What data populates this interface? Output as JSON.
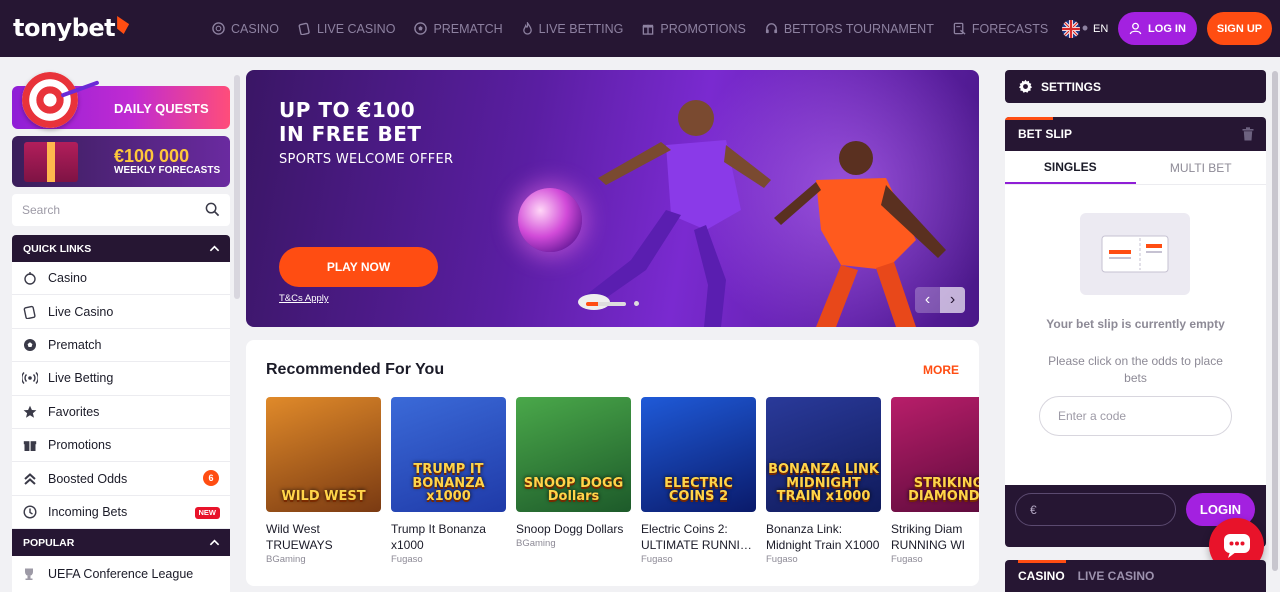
{
  "brand": {
    "name": "tonybet",
    "accent": "#ff4d12",
    "purple": "#a321e0",
    "dark": "#261633"
  },
  "nav": {
    "items": [
      {
        "label": "CASINO",
        "icon": "casino-chip-icon"
      },
      {
        "label": "LIVE CASINO",
        "icon": "live-casino-icon"
      },
      {
        "label": "PREMATCH",
        "icon": "soccer-ball-icon"
      },
      {
        "label": "LIVE BETTING",
        "icon": "flame-icon"
      },
      {
        "label": "PROMOTIONS",
        "icon": "gift-icon"
      },
      {
        "label": "BETTORS TOURNAMENT",
        "icon": "headset-icon"
      },
      {
        "label": "FORECASTS",
        "icon": "forecast-icon"
      }
    ],
    "more": "•••"
  },
  "header": {
    "lang": "EN",
    "login": "LOG IN",
    "signup": "SIGN UP"
  },
  "promos": {
    "daily_quests": "DAILY QUESTS",
    "forecasts_amount": "€100 000",
    "forecasts_label": "WEEKLY FORECASTS"
  },
  "search": {
    "placeholder": "Search"
  },
  "quick_links": {
    "title": "QUICK LINKS",
    "items": [
      {
        "label": "Casino",
        "icon": "casino-chip-icon"
      },
      {
        "label": "Live Casino",
        "icon": "live-casino-icon"
      },
      {
        "label": "Prematch",
        "icon": "soccer-ball-icon"
      },
      {
        "label": "Live Betting",
        "icon": "broadcast-icon"
      },
      {
        "label": "Favorites",
        "icon": "star-icon"
      },
      {
        "label": "Promotions",
        "icon": "gift-icon"
      },
      {
        "label": "Boosted Odds",
        "icon": "double-chevron-up-icon",
        "badge": "6"
      },
      {
        "label": "Incoming Bets",
        "icon": "incoming-bets-icon",
        "badge_new": "NEW"
      }
    ]
  },
  "popular": {
    "title": "POPULAR",
    "items": [
      {
        "label": "UEFA Conference League"
      }
    ]
  },
  "hero": {
    "line1": "UP TO €100",
    "line2": "IN FREE BET",
    "subtitle": "SPORTS WELCOME OFFER",
    "cta": "PLAY NOW",
    "terms": "T&Cs Apply",
    "slide_progress": 0.3
  },
  "recommended": {
    "title": "Recommended For You",
    "more": "MORE",
    "games": [
      {
        "name": "Wild West",
        "name2": "TRUEWAYS",
        "provider": "BGaming",
        "art": "WILD WEST",
        "c1": "#7a3a12",
        "c2": "#e08a2a"
      },
      {
        "name": "Trump It Bonanza",
        "name2": "x1000",
        "provider": "Fugaso",
        "art": "TRUMP IT BONANZA x1000",
        "c1": "#1f3aa8",
        "c2": "#3b6ad8"
      },
      {
        "name": "Snoop Dogg Dollars",
        "name2": "",
        "provider": "BGaming",
        "art": "SNOOP DOGG Dollars",
        "c1": "#1d5a2a",
        "c2": "#4aa84a"
      },
      {
        "name": "Electric Coins 2:",
        "name2": "ULTIMATE RUNNIN...",
        "provider": "Fugaso",
        "art": "ELECTRIC COINS 2",
        "c1": "#0a1a6a",
        "c2": "#1f5ad8"
      },
      {
        "name": "Bonanza Link:",
        "name2": "Midnight Train X1000",
        "provider": "Fugaso",
        "art": "BONANZA LINK MIDNIGHT TRAIN x1000",
        "c1": "#0f1a5a",
        "c2": "#2a3a9a"
      },
      {
        "name": "Striking Diam",
        "name2": "RUNNING WI",
        "provider": "Fugaso",
        "art": "STRIKING DIAMONDS",
        "c1": "#5a0a3a",
        "c2": "#b81e6a"
      }
    ]
  },
  "settings": {
    "label": "SETTINGS"
  },
  "betslip": {
    "title": "BET SLIP",
    "tabs": [
      "SINGLES",
      "MULTI BET"
    ],
    "empty_title": "Your bet slip is currently empty",
    "empty_hint": "Please click on the odds to place bets",
    "code_placeholder": "Enter a code",
    "currency": "€",
    "login": "LOGIN"
  },
  "bottom_tabs": {
    "casino": "CASINO",
    "live_casino": "LIVE CASINO"
  }
}
